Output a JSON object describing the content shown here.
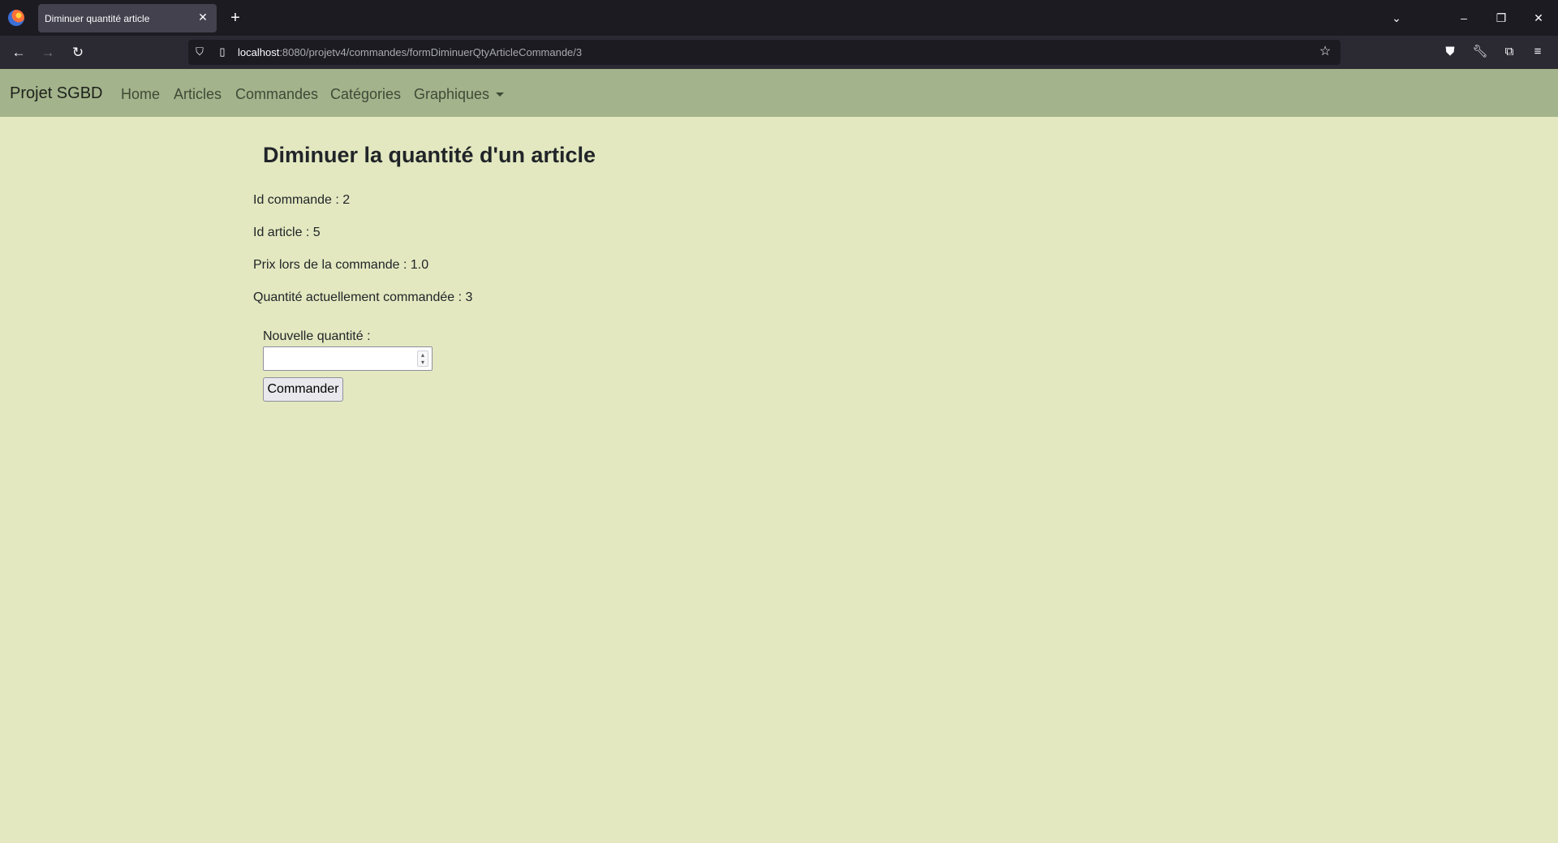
{
  "browser": {
    "tab_title": "Diminuer quantité article",
    "url_host": "localhost",
    "url_path": ":8080/projetv4/commandes/formDiminuerQtyArticleCommande/3"
  },
  "navbar": {
    "brand": "Projet SGBD",
    "links": [
      "Home",
      "Articles",
      "Commandes",
      "Catégories",
      "Graphiques"
    ]
  },
  "main": {
    "title": "Diminuer la quantité d'un article",
    "info": [
      "Id commande : 2",
      "Id article : 5",
      "Prix lors de la commande : 1.0",
      "Quantité actuellement commandée : 3"
    ],
    "form": {
      "label": "Nouvelle quantité :",
      "value": "",
      "submit_label": "Commander"
    }
  },
  "icons": {
    "back": "arrow-left-icon",
    "forward": "arrow-right-icon",
    "reload": "reload-icon",
    "bookmark": "star-icon",
    "pocket": "pocket-icon",
    "devtools": "wrench-icon",
    "extensions": "puzzle-icon",
    "menu": "hamburger-menu-icon"
  }
}
